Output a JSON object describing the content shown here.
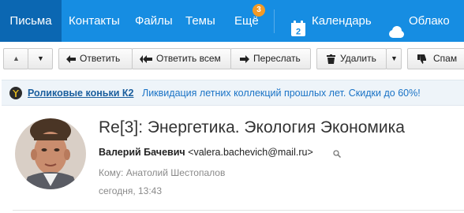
{
  "nav": {
    "items": [
      {
        "label": "Письма"
      },
      {
        "label": "Контакты"
      },
      {
        "label": "Файлы"
      },
      {
        "label": "Темы"
      },
      {
        "label": "Ещё"
      }
    ],
    "more_badge": "3",
    "calendar_label": "Календарь",
    "calendar_icon_day": "2",
    "cloud_label": "Облако"
  },
  "toolbar": {
    "reply": "Ответить",
    "reply_all": "Ответить всем",
    "forward": "Переслать",
    "delete": "Удалить",
    "spam": "Спам"
  },
  "promo": {
    "title": "Роликовые коньки К2",
    "text": "Ликвидация летних коллекций прошлых лет. Скидки до 60%!"
  },
  "message": {
    "subject": "Re[3]: Энергетика. Экология Экономика",
    "sender_name": "Валерий Бачевич",
    "sender_email": "<valera.bachevich@mail.ru>",
    "to": "Кому: Анатолий Шестопалов",
    "date": "сегодня, 13:43"
  },
  "colors": {
    "nav_bg": "#168de2",
    "nav_active": "#0b67b2",
    "badge": "#f39a26",
    "promo_bg": "#eef4f9",
    "link": "#1a73c6"
  }
}
